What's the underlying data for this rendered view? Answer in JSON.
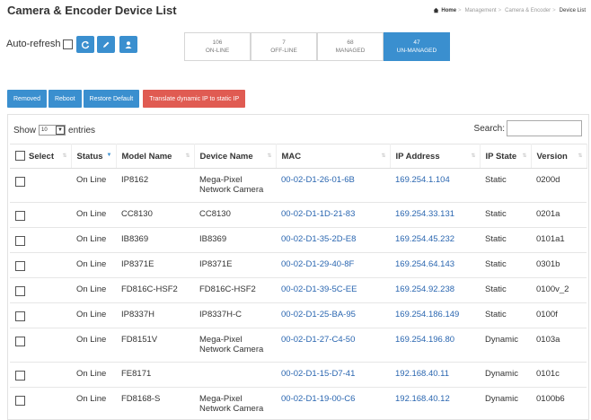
{
  "page": {
    "title": "Camera & Encoder Device List"
  },
  "breadcrumb": {
    "home": "Home",
    "items": [
      "Management",
      "Camera & Encoder"
    ],
    "current": "Device List"
  },
  "toolbar": {
    "autorefresh_label": "Auto-refresh",
    "icons": [
      "refresh-icon",
      "pencil-icon",
      "user-icon"
    ]
  },
  "stats": [
    {
      "value": "106",
      "label": "ON-LINE"
    },
    {
      "value": "7",
      "label": "OFF-LINE"
    },
    {
      "value": "68",
      "label": "MANAGED"
    },
    {
      "value": "47",
      "label": "UN-MANAGED"
    }
  ],
  "actions": {
    "removed": "Removed",
    "reboot": "Reboot",
    "restore": "Restore Default",
    "translate": "Translate dynamic IP to static IP"
  },
  "table_controls": {
    "show_label": "Show",
    "page_size": "10",
    "entries_label": "entries",
    "search_label": "Search:"
  },
  "columns": [
    "Select",
    "Status",
    "Model Name",
    "Device Name",
    "MAC",
    "IP Address",
    "IP State",
    "Version"
  ],
  "rows": [
    {
      "status": "On Line",
      "model": "IP8162",
      "device": "Mega-Pixel\nNetwork Camera",
      "mac": "00-02-D1-26-01-6B",
      "ip": "169.254.1.104",
      "state": "Static",
      "version": "0200d"
    },
    {
      "status": "On Line",
      "model": "CC8130",
      "device": "CC8130",
      "mac": "00-02-D1-1D-21-83",
      "ip": "169.254.33.131",
      "state": "Static",
      "version": "0201a"
    },
    {
      "status": "On Line",
      "model": "IB8369",
      "device": "IB8369",
      "mac": "00-02-D1-35-2D-E8",
      "ip": "169.254.45.232",
      "state": "Static",
      "version": "0101a1"
    },
    {
      "status": "On Line",
      "model": "IP8371E",
      "device": "IP8371E",
      "mac": "00-02-D1-29-40-8F",
      "ip": "169.254.64.143",
      "state": "Static",
      "version": "0301b"
    },
    {
      "status": "On Line",
      "model": "FD816C-HSF2",
      "device": "FD816C-HSF2",
      "mac": "00-02-D1-39-5C-EE",
      "ip": "169.254.92.238",
      "state": "Static",
      "version": "0100v_2"
    },
    {
      "status": "On Line",
      "model": "IP8337H",
      "device": "IP8337H-C",
      "mac": "00-02-D1-25-BA-95",
      "ip": "169.254.186.149",
      "state": "Static",
      "version": "0100f"
    },
    {
      "status": "On Line",
      "model": "FD8151V",
      "device": "Mega-Pixel\nNetwork Camera",
      "mac": "00-02-D1-27-C4-50",
      "ip": "169.254.196.80",
      "state": "Dynamic",
      "version": "0103a"
    },
    {
      "status": "On Line",
      "model": "FE8171",
      "device": "",
      "mac": "00-02-D1-15-D7-41",
      "ip": "192.168.40.11",
      "state": "Dynamic",
      "version": "0101c"
    },
    {
      "status": "On Line",
      "model": "FD8168-S",
      "device": "Mega-Pixel\nNetwork Camera",
      "mac": "00-02-D1-19-00-C6",
      "ip": "192.168.40.12",
      "state": "Dynamic",
      "version": "0100b6"
    }
  ]
}
